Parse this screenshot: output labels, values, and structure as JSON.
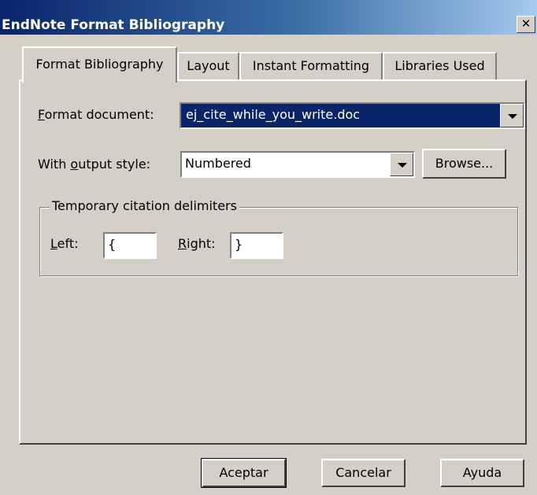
{
  "window": {
    "title": "EndNote Format Bibliography",
    "close_symbol": "✕"
  },
  "tabs": [
    {
      "label": "Format Bibliography",
      "active": true
    },
    {
      "label": "Layout",
      "active": false
    },
    {
      "label": "Instant Formatting",
      "active": false
    },
    {
      "label": "Libraries Used",
      "active": false
    }
  ],
  "form": {
    "format_document": {
      "label_mnemonic": "F",
      "label_rest": "ormat document:",
      "value": "ej_cite_while_you_write.doc"
    },
    "output_style": {
      "label_pre": "With ",
      "label_mnemonic": "o",
      "label_rest": "utput style:",
      "value": "Numbered",
      "browse_label": "Browse..."
    },
    "delimiters": {
      "legend": "Temporary citation delimiters",
      "left_mnemonic": "L",
      "left_rest": "eft:",
      "left_value": "{",
      "right_mnemonic": "R",
      "right_rest": "ight:",
      "right_value": "}"
    }
  },
  "footer": {
    "ok_label": "Aceptar",
    "cancel_label": "Cancelar",
    "help_label": "Ayuda"
  },
  "colors": {
    "titlebar_start": "#0a246a",
    "titlebar_end": "#a6caf0",
    "face": "#d4d0c8",
    "selection": "#0a246a"
  }
}
